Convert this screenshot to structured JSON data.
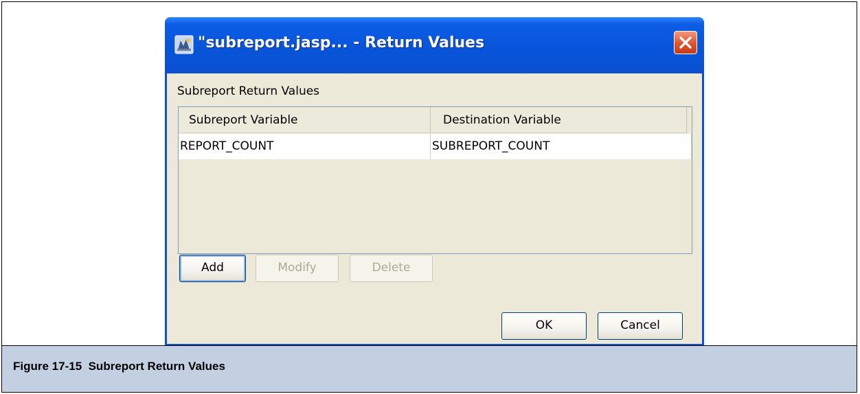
{
  "window": {
    "title": "\"subreport.jasp... - Return Values"
  },
  "dialog": {
    "section_label": "Subreport Return Values",
    "table": {
      "columns": [
        "Subreport Variable",
        "Destination Variable"
      ],
      "rows": [
        [
          "REPORT_COUNT",
          "SUBREPORT_COUNT"
        ]
      ]
    },
    "buttons": {
      "add": "Add",
      "modify": "Modify",
      "delete": "Delete",
      "ok": "OK",
      "cancel": "Cancel"
    }
  },
  "caption": "Figure 17-15  Subreport Return Values",
  "icons": {
    "app": "jasper-app-icon",
    "close": "close-icon"
  },
  "colors": {
    "titlebar": "#0754d8",
    "client_bg": "#ece9d8",
    "close_button": "#e0542f",
    "caption_bar": "#c3d0e2"
  }
}
